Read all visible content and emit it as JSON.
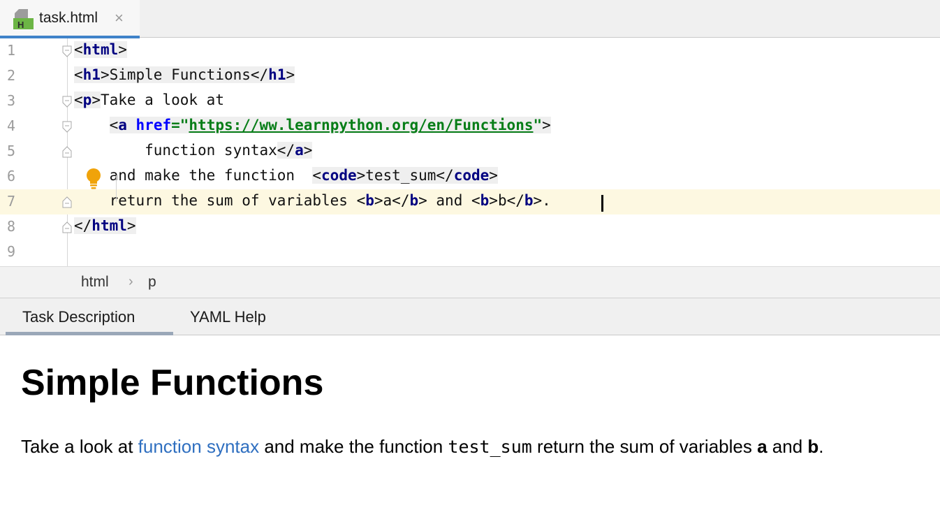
{
  "tab": {
    "title": "task.html",
    "close_glyph": "×",
    "icon_letter": "H"
  },
  "editor": {
    "line_numbers": [
      "1",
      "2",
      "3",
      "4",
      "5",
      "6",
      "7",
      "8",
      "9"
    ],
    "lines": [
      [
        {
          "t": "<",
          "c": "hl"
        },
        {
          "t": "html",
          "c": "tag hl"
        },
        {
          "t": ">",
          "c": "hl"
        }
      ],
      [
        {
          "t": "<",
          "c": "hl"
        },
        {
          "t": "h1",
          "c": "tag hl"
        },
        {
          "t": ">Simple Functions</",
          "c": "hl"
        },
        {
          "t": "h1",
          "c": "tag hl"
        },
        {
          "t": ">",
          "c": "hl"
        }
      ],
      [
        {
          "t": "<",
          "c": "hl"
        },
        {
          "t": "p",
          "c": "tag hl"
        },
        {
          "t": ">",
          "c": "hl"
        },
        {
          "t": "Take a look at",
          "c": ""
        }
      ],
      [
        {
          "t": "    ",
          "c": ""
        },
        {
          "t": "<",
          "c": "hl"
        },
        {
          "t": "a ",
          "c": "tag hl"
        },
        {
          "t": "href",
          "c": "attr hl"
        },
        {
          "t": "=\"",
          "c": "str hl"
        },
        {
          "t": "https://ww.learnpython.org/en/Functions",
          "c": "url hl"
        },
        {
          "t": "\"",
          "c": "str hl"
        },
        {
          "t": ">",
          "c": "hl"
        }
      ],
      [
        {
          "t": "        function syntax",
          "c": ""
        },
        {
          "t": "</",
          "c": "hl"
        },
        {
          "t": "a",
          "c": "tag hl"
        },
        {
          "t": ">",
          "c": "hl"
        }
      ],
      [
        {
          "t": "    and make the function  ",
          "c": ""
        },
        {
          "t": "<",
          "c": "hl"
        },
        {
          "t": "code",
          "c": "tag hl"
        },
        {
          "t": ">test_sum</",
          "c": "hl"
        },
        {
          "t": "code",
          "c": "tag hl"
        },
        {
          "t": ">",
          "c": "hl"
        }
      ],
      [
        {
          "t": "    return the sum of variables ",
          "c": ""
        },
        {
          "t": "<",
          "c": ""
        },
        {
          "t": "b",
          "c": "tag"
        },
        {
          "t": ">a</",
          "c": ""
        },
        {
          "t": "b",
          "c": "tag"
        },
        {
          "t": "> and <",
          "c": ""
        },
        {
          "t": "b",
          "c": "tag"
        },
        {
          "t": ">b</",
          "c": ""
        },
        {
          "t": "b",
          "c": "tag"
        },
        {
          "t": ">.",
          "c": ""
        }
      ],
      [
        {
          "t": "</",
          "c": "hl"
        },
        {
          "t": "html",
          "c": "tag hl"
        },
        {
          "t": ">",
          "c": "hl"
        }
      ],
      []
    ]
  },
  "breadcrumb": {
    "items": [
      "html",
      "p"
    ],
    "separator": "›"
  },
  "panel_tabs": {
    "task_description": "Task Description",
    "yaml_help": "YAML Help"
  },
  "description": {
    "heading": "Simple Functions",
    "text_1": "Take a look at ",
    "link": "function syntax",
    "text_2": " and make the function ",
    "code": "test_sum",
    "text_3": " return the sum of variables ",
    "var_a": "a",
    "text_4": " and ",
    "var_b": "b",
    "text_5": "."
  },
  "colors": {
    "accent": "#4083c9",
    "tag": "#000080",
    "attribute": "#0000ff",
    "string": "#067d17",
    "link": "#2f6fc0",
    "current_line": "#fdf8e1",
    "bulb": "#f0a30a"
  },
  "icons": [
    "html-file-icon",
    "close-icon",
    "fold-marker-icon",
    "intention-bulb-icon",
    "chevron-right-icon"
  ]
}
